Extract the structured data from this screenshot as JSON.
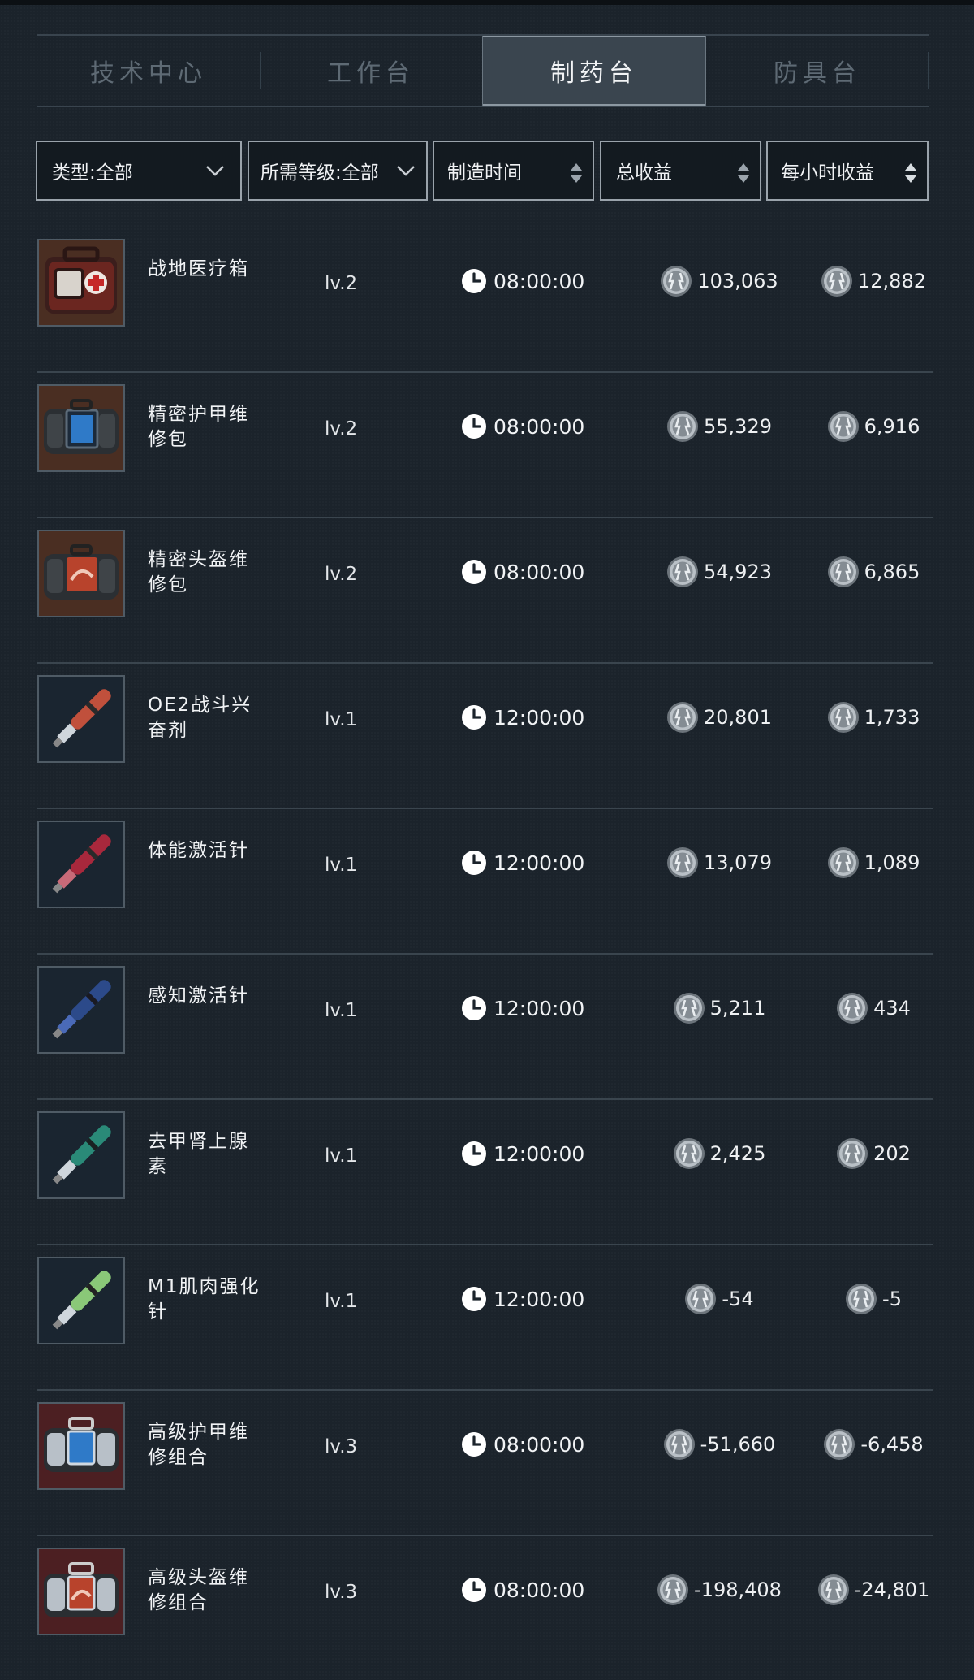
{
  "tabs": [
    {
      "label": "技术中心",
      "active": false
    },
    {
      "label": "工作台",
      "active": false
    },
    {
      "label": "制药台",
      "active": true
    },
    {
      "label": "防具台",
      "active": false
    }
  ],
  "filters": {
    "type": "类型:全部",
    "level": "所需等级:全部",
    "time": "制造时间",
    "total": "总收益",
    "hourly": "每小时收益"
  },
  "items": [
    {
      "name": "战地医疗箱",
      "level": "lv.2",
      "time": "08:00:00",
      "total": "103,063",
      "hourly": "12,882",
      "icon": "medical-kit-icon"
    },
    {
      "name": "精密护甲维修包",
      "level": "lv.2",
      "time": "08:00:00",
      "total": "55,329",
      "hourly": "6,916",
      "icon": "armor-repair-kit-icon"
    },
    {
      "name": "精密头盔维修包",
      "level": "lv.2",
      "time": "08:00:00",
      "total": "54,923",
      "hourly": "6,865",
      "icon": "helmet-repair-kit-icon"
    },
    {
      "name": "OE2战斗兴奋剂",
      "level": "lv.1",
      "time": "12:00:00",
      "total": "20,801",
      "hourly": "1,733",
      "icon": "stimulant-injector-icon"
    },
    {
      "name": "体能激活针",
      "level": "lv.1",
      "time": "12:00:00",
      "total": "13,079",
      "hourly": "1,089",
      "icon": "stamina-injector-icon"
    },
    {
      "name": "感知激活针",
      "level": "lv.1",
      "time": "12:00:00",
      "total": "5,211",
      "hourly": "434",
      "icon": "perception-injector-icon"
    },
    {
      "name": "去甲肾上腺素",
      "level": "lv.1",
      "time": "12:00:00",
      "total": "2,425",
      "hourly": "202",
      "icon": "norepinephrine-injector-icon"
    },
    {
      "name": "M1肌肉强化针",
      "level": "lv.1",
      "time": "12:00:00",
      "total": "-54",
      "hourly": "-5",
      "icon": "muscle-injector-icon"
    },
    {
      "name": "高级护甲维修组合",
      "level": "lv.3",
      "time": "08:00:00",
      "total": "-51,660",
      "hourly": "-6,458",
      "icon": "advanced-armor-repair-icon"
    },
    {
      "name": "高级头盔维修组合",
      "level": "lv.3",
      "time": "08:00:00",
      "total": "-198,408",
      "hourly": "-24,801",
      "icon": "advanced-helmet-repair-icon"
    }
  ],
  "colors": {
    "background": "#1b232b",
    "active_tab": "#3a454f",
    "divider": "#3a454e",
    "injector_red": "#c0503c",
    "injector_crimson": "#a8283c",
    "injector_blue": "#2c4a8a",
    "injector_teal": "#2a8a78",
    "injector_green": "#8ac878"
  }
}
